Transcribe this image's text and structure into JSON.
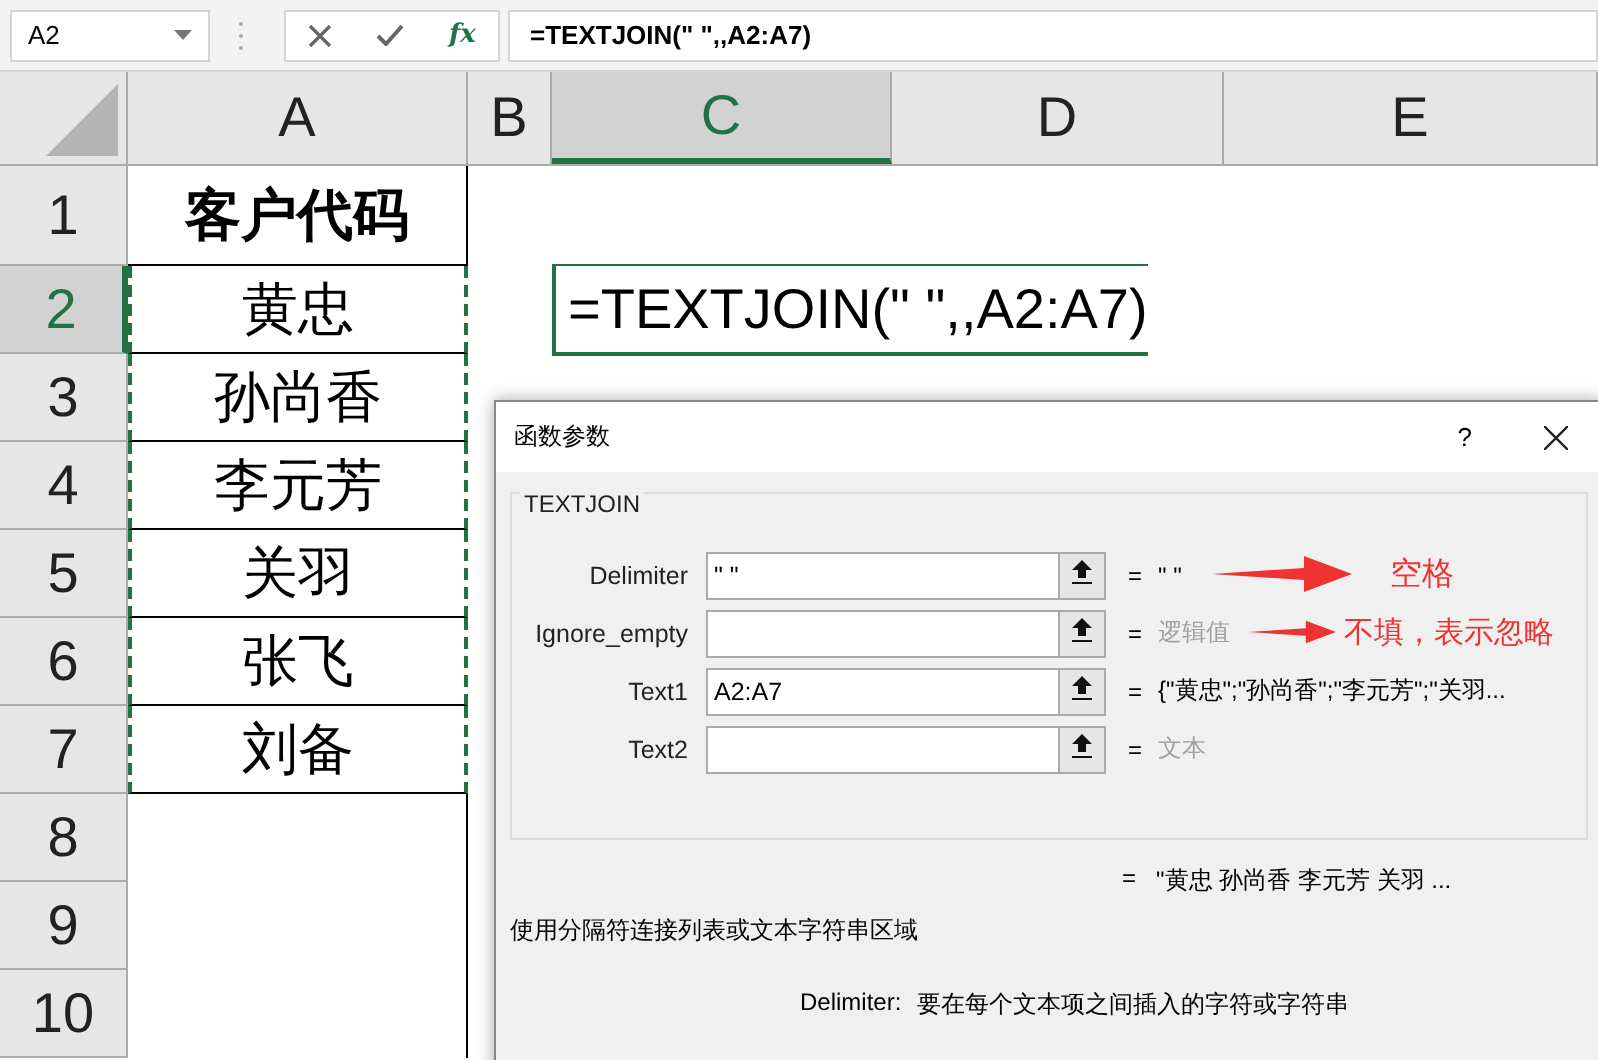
{
  "formula_bar": {
    "name_box": "A2",
    "fx": "fx",
    "formula": "=TEXTJOIN(\" \",,A2:A7)"
  },
  "columns": [
    {
      "label": "A",
      "selected": false
    },
    {
      "label": "B",
      "selected": false
    },
    {
      "label": "C",
      "selected": true
    },
    {
      "label": "D",
      "selected": false
    },
    {
      "label": "E",
      "selected": false
    }
  ],
  "rows": [
    {
      "label": "1",
      "selected": false,
      "in_range": false,
      "cell_a": "客户代码"
    },
    {
      "label": "2",
      "selected": true,
      "in_range": true,
      "cell_a": "黄忠",
      "cell_c": "=TEXTJOIN(\" \",,A2:A7)"
    },
    {
      "label": "3",
      "selected": false,
      "in_range": true,
      "cell_a": "孙尚香"
    },
    {
      "label": "4",
      "selected": false,
      "in_range": true,
      "cell_a": "李元芳"
    },
    {
      "label": "5",
      "selected": false,
      "in_range": true,
      "cell_a": "关羽"
    },
    {
      "label": "6",
      "selected": false,
      "in_range": true,
      "cell_a": "张飞"
    },
    {
      "label": "7",
      "selected": false,
      "in_range": true,
      "cell_a": "刘备"
    },
    {
      "label": "8",
      "selected": false,
      "in_range": false
    },
    {
      "label": "9",
      "selected": false,
      "in_range": false
    },
    {
      "label": "10",
      "selected": false,
      "in_range": false
    }
  ],
  "dialog": {
    "title": "函数参数",
    "help": "?",
    "group": "TEXTJOIN",
    "arguments": [
      {
        "label": "Delimiter",
        "value": "\" \"",
        "equals": "=",
        "result": "\" \"",
        "result_muted": false,
        "note": "空格"
      },
      {
        "label": "Ignore_empty",
        "equals": "=",
        "result": "逻辑值",
        "result_muted": true,
        "note": "不填，表示忽略"
      },
      {
        "label": "Text1",
        "value": "A2:A7",
        "equals": "=",
        "result": "{\"黄忠\";\"孙尚香\";\"李元芳\";\"关羽...",
        "result_muted": false
      },
      {
        "label": "Text2",
        "equals": "=",
        "result": "文本",
        "result_muted": true
      }
    ],
    "result_equals": "=",
    "result": "\"黄忠 孙尚香 李元芳 关羽 ...",
    "description": "使用分隔符连接列表或文本字符串区域",
    "arg_help_label": "Delimiter:",
    "arg_help": "要在每个文本项之间插入的字符或字符串"
  }
}
